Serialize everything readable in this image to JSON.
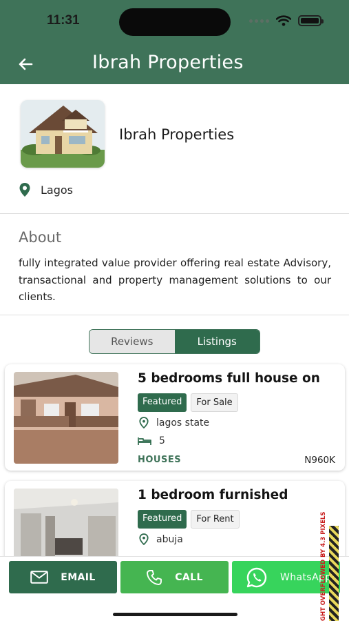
{
  "status_bar": {
    "time": "11:31"
  },
  "header": {
    "title": "Ibrah Properties"
  },
  "profile": {
    "name": "Ibrah Properties",
    "location": "Lagos"
  },
  "about": {
    "title": "About",
    "text": "fully integrated value provider offering real estate Advisory, transactional and property management solutions to our clients."
  },
  "tabs": [
    {
      "label": "Reviews",
      "active": false
    },
    {
      "label": "Listings",
      "active": true
    }
  ],
  "listings": [
    {
      "title": "5 bedrooms full house on",
      "badge_featured": "Featured",
      "badge_status": "For Sale",
      "location": "lagos state",
      "bedrooms": "5",
      "type": "HOUSES",
      "price": "N960K"
    },
    {
      "title": "1 bedroom furnished",
      "badge_featured": "Featured",
      "badge_status": "For Rent",
      "location": "abuja",
      "bedrooms": "",
      "type": "",
      "price": ""
    }
  ],
  "actions": {
    "email": "EMAIL",
    "call": "CALL",
    "whatsapp": "WhatsApp"
  },
  "overflow_warning": "GHT OVERFLOWED BY 4.3 PIXELS",
  "colors": {
    "primary": "#3f7359",
    "accent_dark": "#2f6b4d",
    "call_green": "#45b551",
    "whatsapp_green": "#37d45c"
  },
  "icons": [
    "back-arrow-icon",
    "location-pin-icon",
    "bed-icon",
    "mail-icon",
    "phone-icon",
    "whatsapp-icon",
    "wifi-icon",
    "battery-icon"
  ]
}
